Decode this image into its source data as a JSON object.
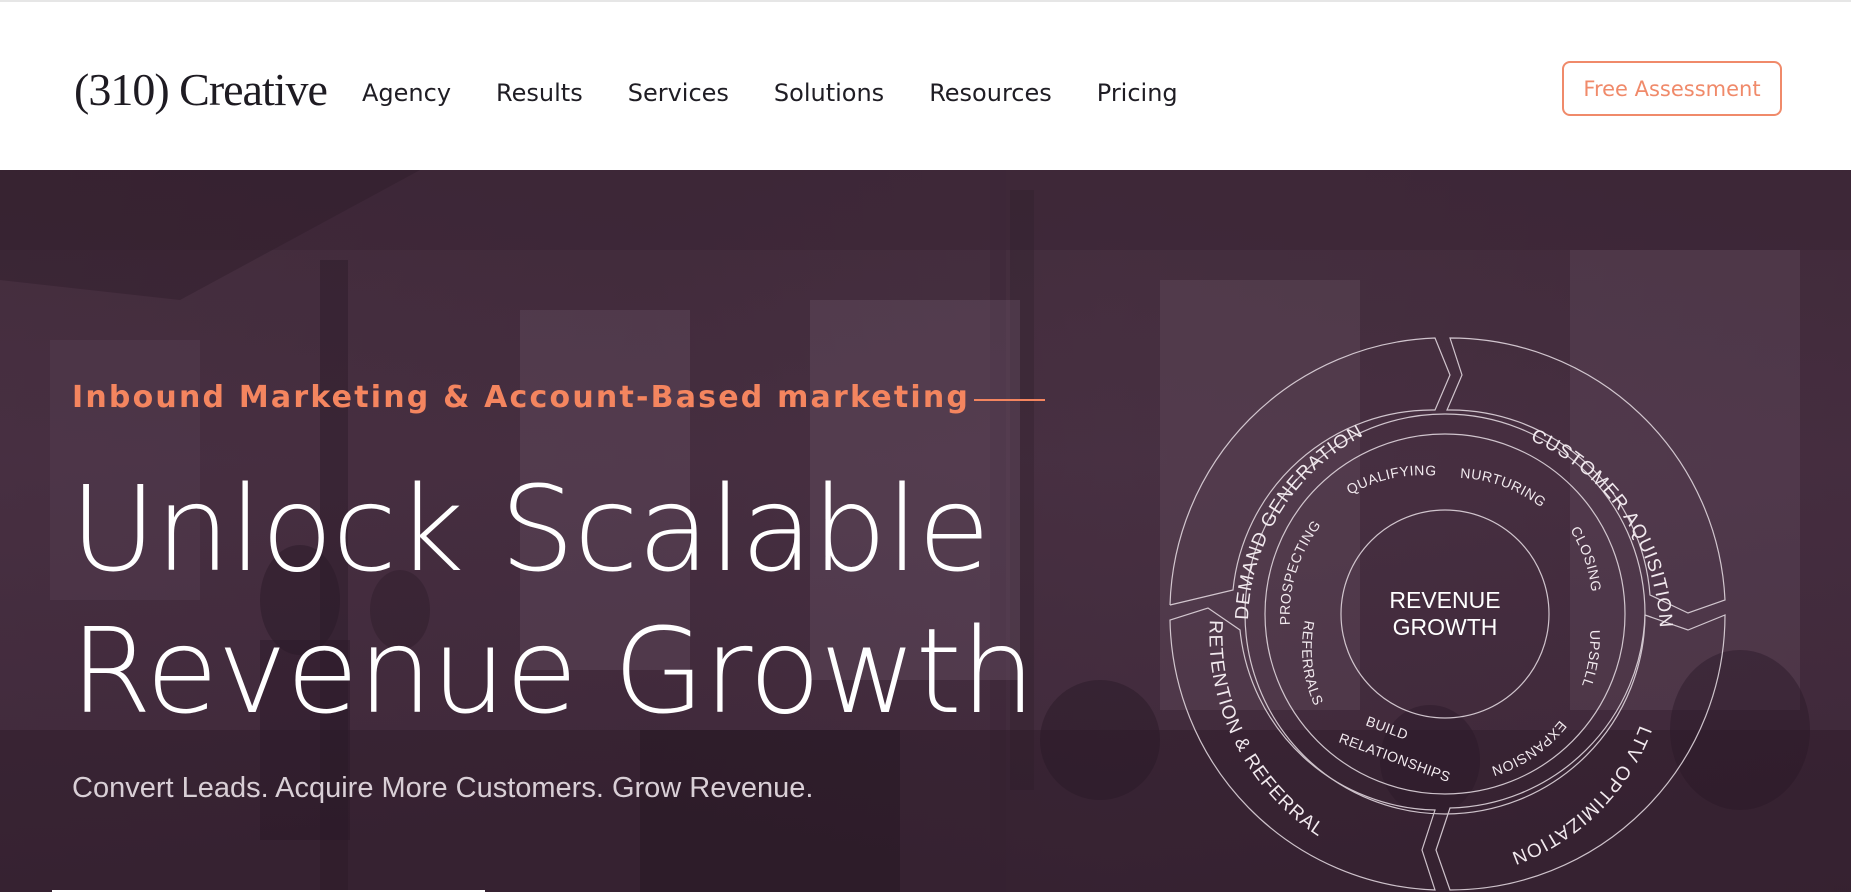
{
  "brand": {
    "logo_text": "(310) Creative"
  },
  "nav": {
    "items": [
      "Agency",
      "Results",
      "Services",
      "Solutions",
      "Resources",
      "Pricing"
    ]
  },
  "cta": {
    "label": "Free Assessment",
    "color": "#f08a6a"
  },
  "hero": {
    "eyebrow": "Inbound Marketing & Account-Based marketing",
    "headline_line1": "Unlock Scalable",
    "headline_line2": "Revenue Growth",
    "subline": "Convert Leads. Acquire More Customers. Grow Revenue.",
    "accent_color": "#f4855f"
  },
  "wheel": {
    "center_line1": "REVENUE",
    "center_line2": "GROWTH",
    "outer": [
      "DEMAND GENERATION",
      "CUSTOMER  AQUISITION",
      "LTV OPTIMIZATION",
      "RETENTION & REFERRAL"
    ],
    "inner": [
      "QUALIFYING",
      "NURTURING",
      "CLOSING",
      "UPSELL",
      "EXPANSION",
      "BUILD",
      "RELATIONSHIPS",
      "REFERRALS",
      "PROSPECTING"
    ]
  }
}
